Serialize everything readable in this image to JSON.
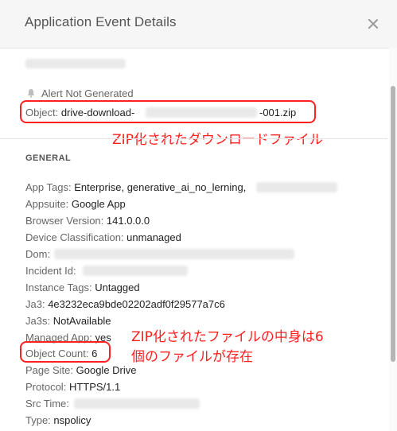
{
  "dialog": {
    "title": "Application Event Details"
  },
  "alert_status": "Alert Not Generated",
  "object": {
    "label": "Object:",
    "value_prefix": "drive-download-",
    "value_suffix": "-001.zip"
  },
  "annotations": {
    "zip_note": "ZIP化されたダウンロードファイル",
    "count_note_line1": "ZIP化されたファイルの中身は6",
    "count_note_line2": "個のファイルが存在"
  },
  "section_general": "GENERAL",
  "details": [
    {
      "key": "App Tags:",
      "value": "Enterprise, generative_ai_no_lerning,"
    },
    {
      "key": "Appsuite:",
      "value": "Google App"
    },
    {
      "key": "Browser Version:",
      "value": "141.0.0.0"
    },
    {
      "key": "Device Classification:",
      "value": "unmanaged"
    },
    {
      "key": "Dom:",
      "value": ""
    },
    {
      "key": "Incident Id:",
      "value": ""
    },
    {
      "key": "Instance Tags:",
      "value": "Untagged"
    },
    {
      "key": "Ja3:",
      "value": "4e3232eca9bde02202adf0f29577a7c6"
    },
    {
      "key": "Ja3s:",
      "value": "NotAvailable"
    },
    {
      "key": "Managed App:",
      "value": "yes"
    },
    {
      "key": "Object Count:",
      "value": "6"
    },
    {
      "key": "Page Site:",
      "value": "Google Drive"
    },
    {
      "key": "Protocol:",
      "value": "HTTPS/1.1"
    },
    {
      "key": "Src Time:",
      "value": ""
    },
    {
      "key": "Type:",
      "value": "nspolicy"
    }
  ],
  "colors": {
    "annotation_red": "#ff2020",
    "header_bg": "#f6f6f6"
  },
  "icons": [
    "close-icon",
    "bell-icon"
  ]
}
